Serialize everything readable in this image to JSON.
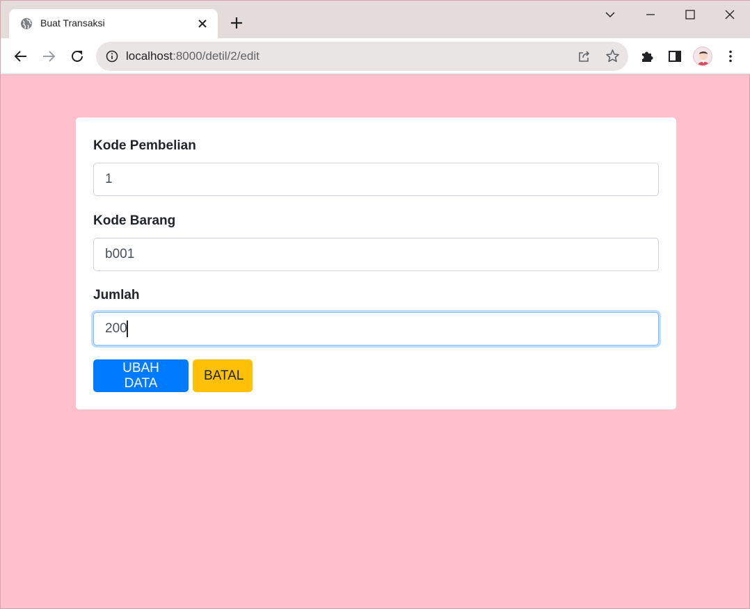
{
  "browser": {
    "tab": {
      "title": "Buat Transaksi",
      "favicon": "globe-icon"
    },
    "url": {
      "host": "localhost",
      "path": ":8000/detil/2/edit"
    }
  },
  "form": {
    "fields": [
      {
        "label": "Kode Pembelian",
        "value": "1"
      },
      {
        "label": "Kode Barang",
        "value": "b001"
      },
      {
        "label": "Jumlah",
        "value": "200"
      }
    ],
    "buttons": {
      "submit_label": "UBAH DATA",
      "cancel_label": "BATAL"
    }
  },
  "colors": {
    "page_background": "#ffc0cb",
    "primary": "#007bff",
    "warning": "#ffc107"
  }
}
